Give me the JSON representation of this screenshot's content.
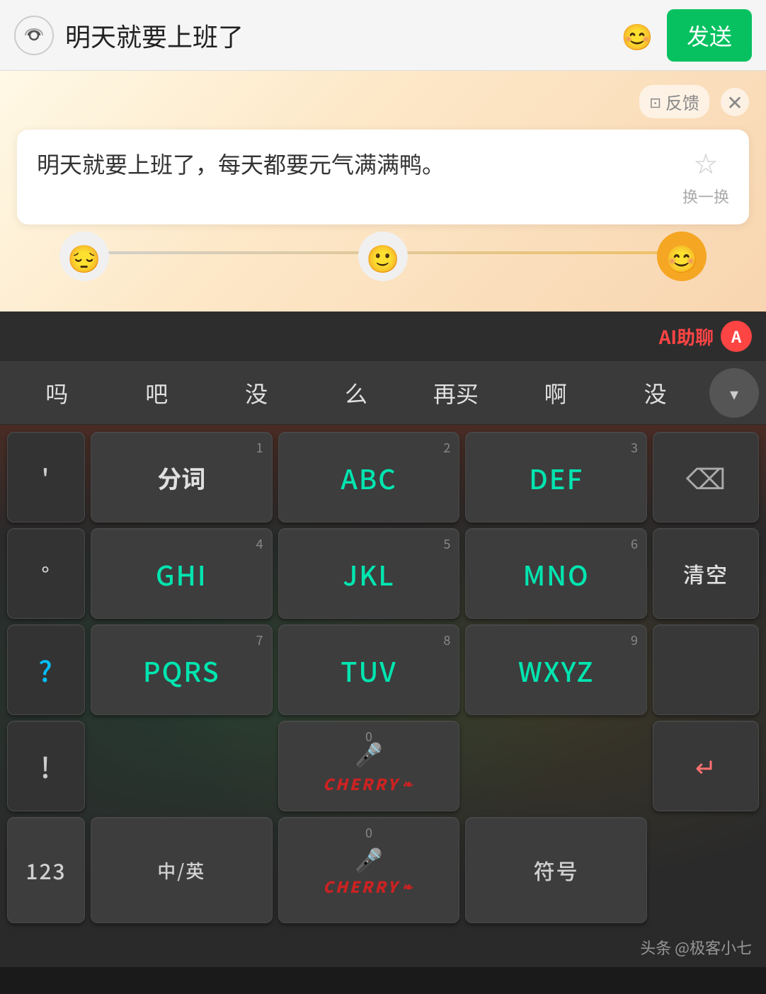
{
  "topBar": {
    "inputText": "明天就要上班了",
    "sendLabel": "发送",
    "voiceIcon": "⊚",
    "emojiIcon": "😊"
  },
  "suggestion": {
    "feedbackLabel": "反馈",
    "closeIcon": "✕",
    "text": "明天就要上班了，每天都要元气满满鸭。",
    "refreshLabel": "换一换",
    "emotions": [
      {
        "label": "😔",
        "state": "inactive"
      },
      {
        "label": "🙂",
        "state": "inactive"
      },
      {
        "label": "😊",
        "state": "active"
      }
    ]
  },
  "aiBar": {
    "label": "AI助聊",
    "iconText": "A"
  },
  "wordRow": {
    "words": [
      "吗",
      "吧",
      "没",
      "么",
      "再买",
      "啊",
      "没"
    ],
    "expandIcon": "▼"
  },
  "keyboard": {
    "row1": {
      "left": "'",
      "k1": {
        "num": "1",
        "label": "分词"
      },
      "k2": {
        "num": "2",
        "label": "ABC"
      },
      "k3": {
        "num": "3",
        "label": "DEF"
      },
      "right": "⌫"
    },
    "row2": {
      "left": "°",
      "k4": {
        "num": "4",
        "label": "GHI"
      },
      "k5": {
        "num": "5",
        "label": "JKL"
      },
      "k6": {
        "num": "6",
        "label": "MNO"
      },
      "right": "清空"
    },
    "row3": {
      "left": "?",
      "k7": {
        "num": "7",
        "label": "PQRS"
      },
      "k8": {
        "num": "8",
        "label": "TUV"
      },
      "k9": {
        "num": "9",
        "label": "WXYZ"
      },
      "right": ""
    },
    "row4": {
      "left": "!",
      "k0num": "0",
      "right": "↵"
    },
    "bottomRow": {
      "k_123": "123",
      "k_lang": "中/英",
      "k_zero": "0",
      "k_mic": "🎤",
      "k_cherry": "CHERRY",
      "k_symbol": "符号"
    }
  },
  "watermark": {
    "text": "头条 @极客小七"
  }
}
